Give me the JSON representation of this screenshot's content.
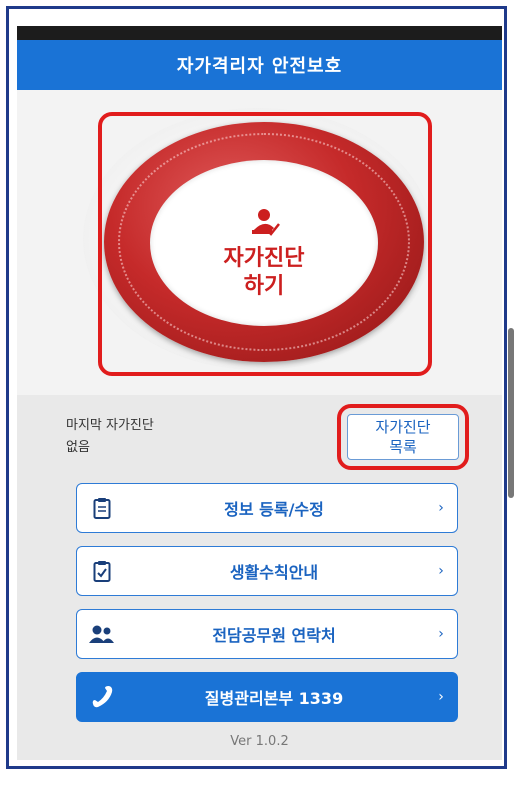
{
  "app": {
    "title": "자가격리자 안전보호"
  },
  "hero": {
    "self_diagnosis_line1": "자가진단",
    "self_diagnosis_line2": "하기"
  },
  "status": {
    "last_label": "마지막 자가진단",
    "last_value": "없음"
  },
  "list_button": {
    "line1": "자가진단",
    "line2": "목록"
  },
  "menu": [
    {
      "label": "정보 등록/수정",
      "icon": "clipboard-icon",
      "chevron": "›"
    },
    {
      "label": "생활수칙안내",
      "icon": "clipboard-check-icon",
      "chevron": "›"
    },
    {
      "label": "전담공무원 연락처",
      "icon": "contacts-icon",
      "chevron": "›"
    },
    {
      "label": "질병관리본부 1339",
      "icon": "phone-icon",
      "chevron": "›"
    }
  ],
  "footer": {
    "version": "Ver 1.0.2"
  },
  "colors": {
    "primary": "#1a73d6",
    "accent_red": "#cc1f1f",
    "highlight": "#e11c1c"
  }
}
